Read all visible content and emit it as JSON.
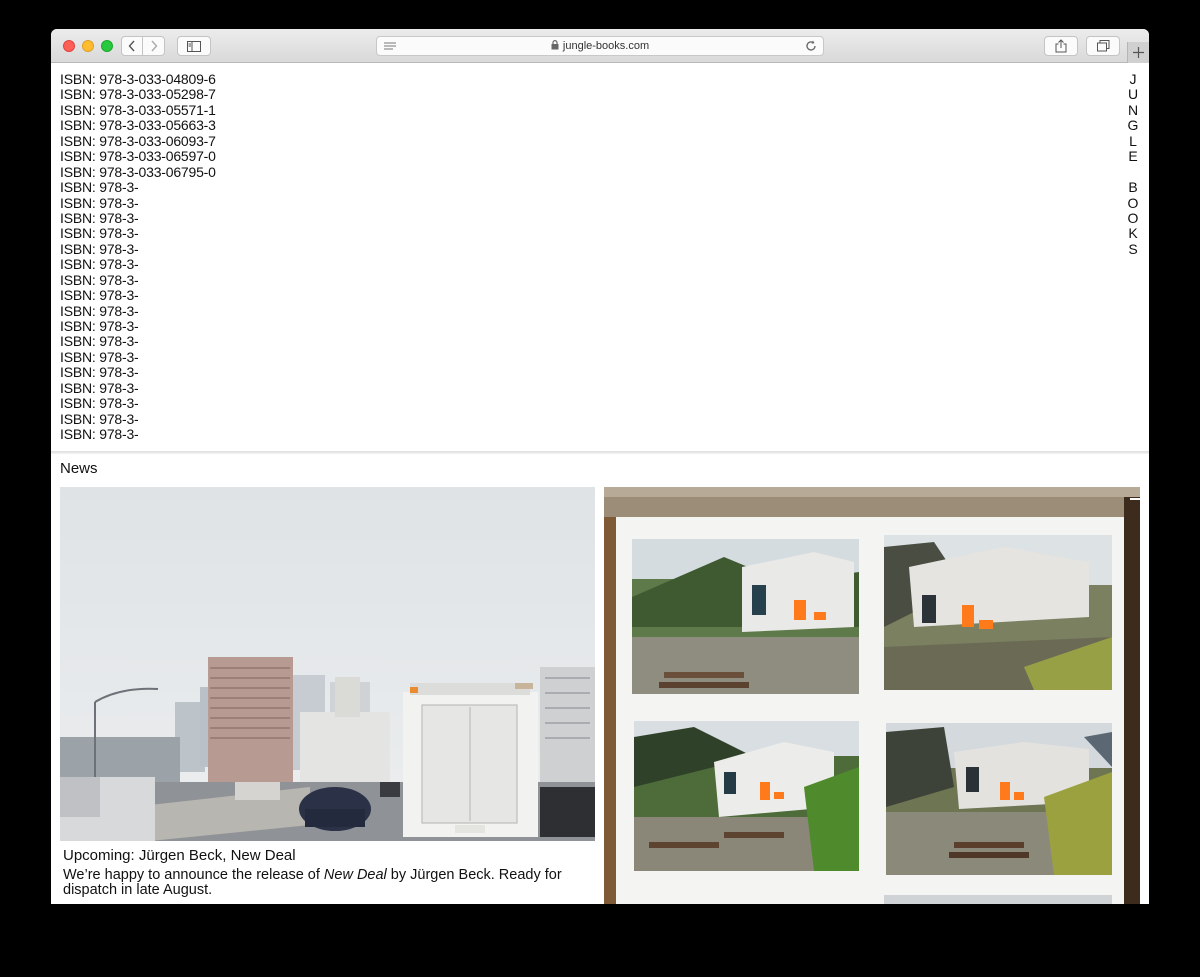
{
  "browser": {
    "url": "jungle-books.com"
  },
  "isbn_list": [
    "ISBN: 978-3-033-04809-6",
    "ISBN: 978-3-033-05298-7",
    "ISBN: 978-3-033-05571-1",
    "ISBN: 978-3-033-05663-3",
    "ISBN: 978-3-033-06093-7",
    "ISBN: 978-3-033-06597-0",
    "ISBN: 978-3-033-06795-0",
    "ISBN: 978-3-",
    "ISBN: 978-3-",
    "ISBN: 978-3-",
    "ISBN: 978-3-",
    "ISBN: 978-3-",
    "ISBN: 978-3-",
    "ISBN: 978-3-",
    "ISBN: 978-3-",
    "ISBN: 978-3-",
    "ISBN: 978-3-",
    "ISBN: 978-3-",
    "ISBN: 978-3-",
    "ISBN: 978-3-",
    "ISBN: 978-3-",
    "ISBN: 978-3-",
    "ISBN: 978-3-",
    "ISBN: 978-3-"
  ],
  "logo_letters": [
    "J",
    "U",
    "N",
    "G",
    "L",
    "E",
    " ",
    "B",
    "O",
    "O",
    "K",
    "S"
  ],
  "news": {
    "heading": "News",
    "item": {
      "title": "Upcoming: Jürgen Beck, New Deal",
      "body_before": "We’re happy to announce the release of ",
      "body_title": "New Deal",
      "body_after": " by Jürgen Beck. Ready for dispatch in late August."
    }
  },
  "colors": {
    "accent_orange": "#ff7a1a"
  },
  "icons": {
    "back": "chevron-left-icon",
    "forward": "chevron-right-icon",
    "sidebar": "sidebar-icon",
    "share": "share-icon",
    "tabs": "tabs-icon",
    "reader": "reader-icon",
    "lock": "lock-icon",
    "reload": "reload-icon",
    "new_tab": "plus-icon"
  }
}
